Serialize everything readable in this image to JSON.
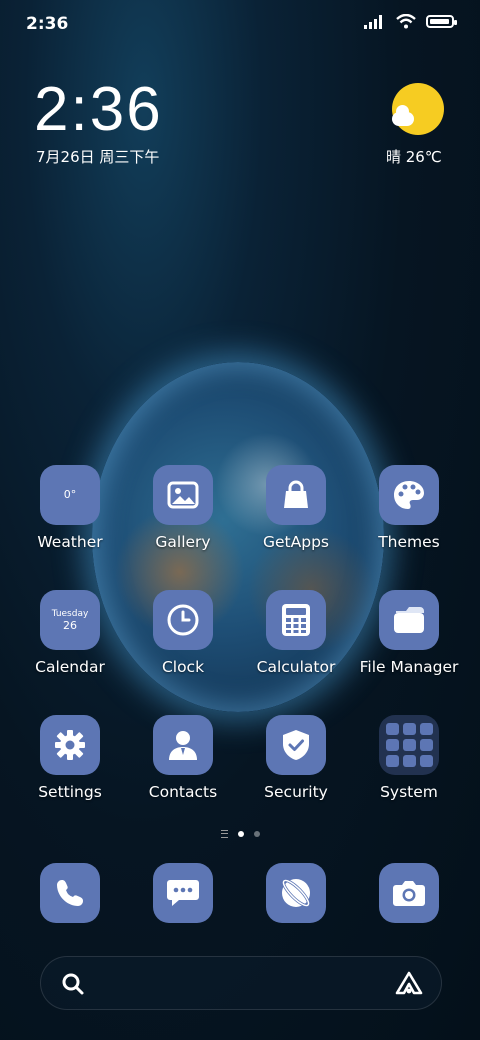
{
  "status_bar": {
    "time": "2:36",
    "icons": [
      "signal-icon",
      "wifi-icon",
      "battery-icon"
    ]
  },
  "lockwidget": {
    "time": "2:36",
    "date": "7月26日 周三下午"
  },
  "weather_widget": {
    "condition_temp": "晴 26℃",
    "icon": "sun-cloud-icon"
  },
  "apps": [
    {
      "label": "Weather",
      "icon_text": "0°"
    },
    {
      "label": "Gallery",
      "icon": "gallery-icon"
    },
    {
      "label": "GetApps",
      "icon": "bag-icon"
    },
    {
      "label": "Themes",
      "icon": "palette-icon"
    },
    {
      "label": "Calendar",
      "icon_day": "Tuesday",
      "icon_date": "26"
    },
    {
      "label": "Clock",
      "icon": "clock-icon"
    },
    {
      "label": "Calculator",
      "icon": "calculator-icon"
    },
    {
      "label": "File Manager",
      "icon": "folder-icon"
    },
    {
      "label": "Settings",
      "icon": "gear-icon"
    },
    {
      "label": "Contacts",
      "icon": "person-icon"
    },
    {
      "label": "Security",
      "icon": "shield-icon"
    },
    {
      "label": "System",
      "icon": "folder-grid-icon"
    }
  ],
  "page_indicator": {
    "pages": 2,
    "current": 1
  },
  "dock": [
    "phone-icon",
    "messages-icon",
    "browser-icon",
    "camera-icon"
  ],
  "search_bar": {
    "icons": [
      "search-icon",
      "assistant-icon"
    ]
  },
  "colors": {
    "icon_bg": "#5d76b4",
    "sun": "#f6cc22"
  }
}
